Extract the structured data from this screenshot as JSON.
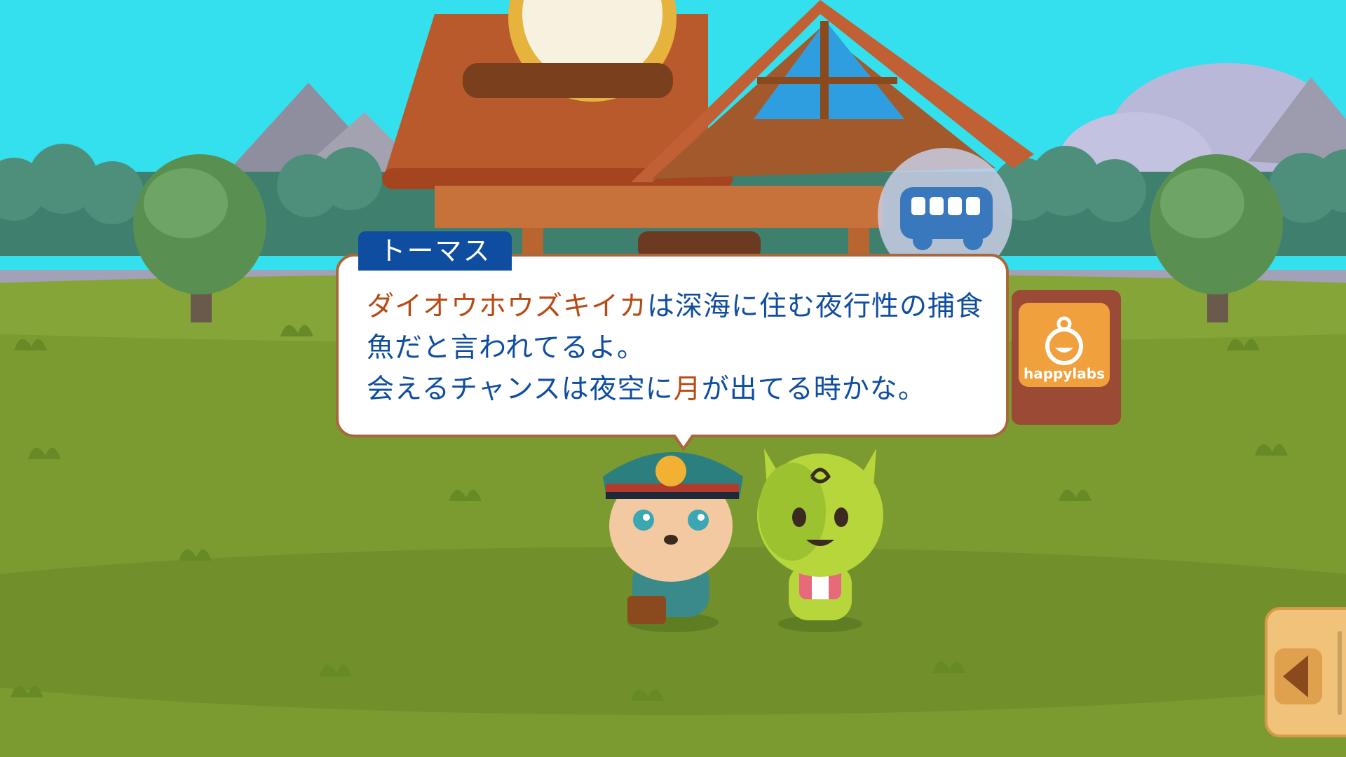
{
  "dialog": {
    "speaker": "トーマス",
    "line1_highlight": "ダイオウホウズキイカ",
    "line1_rest": "は深海に住む夜行性の捕食",
    "line2": "魚だと言われてるよ。",
    "line3_before": "会えるチャンスは夜空に",
    "line3_highlight": "月",
    "line3_after": "が出てる時かな。"
  },
  "sign": {
    "logo_text": "happylabs"
  },
  "icons": {
    "bus": "bus-icon",
    "side_arrow": "chevron-left-icon",
    "clock": "clock-icon"
  },
  "colors": {
    "sky": "#34dfee",
    "grass": "#7b9b31",
    "dialog_text": "#0f4da1",
    "dialog_highlight": "#b84a14",
    "dialog_border": "#a9683b",
    "speaker_tag": "#0f4da1"
  }
}
